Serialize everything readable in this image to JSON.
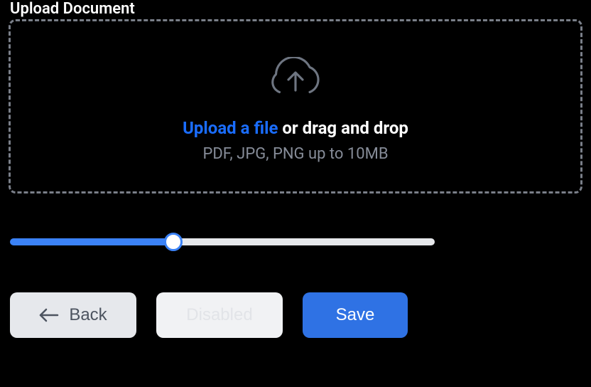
{
  "upload": {
    "label": "Upload Document",
    "link_text": "Upload a file",
    "drag_text": " or drag and drop",
    "hint": "PDF, JPG, PNG up to 10MB"
  },
  "slider": {
    "value": 37.5,
    "min": 0,
    "max": 100
  },
  "buttons": {
    "back": "Back",
    "disabled": "Disabled",
    "save": "Save"
  }
}
